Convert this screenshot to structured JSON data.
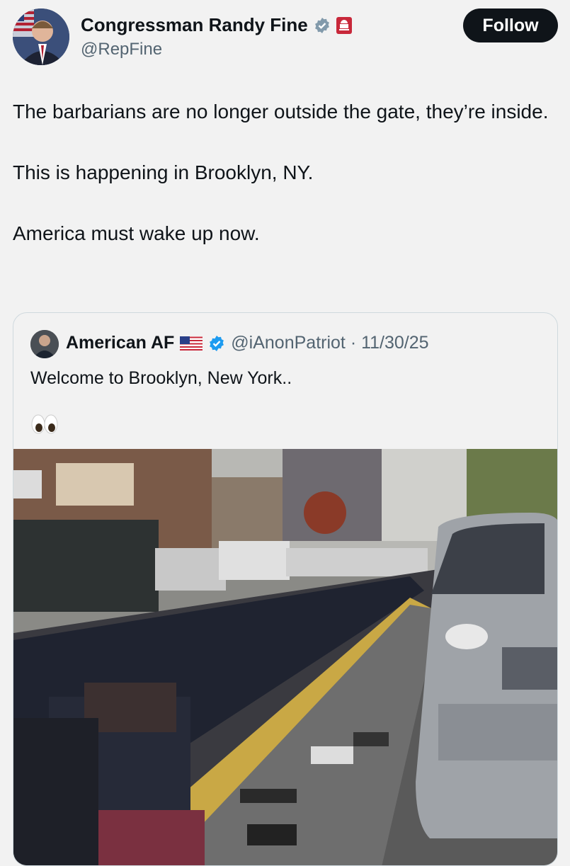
{
  "author": {
    "name": "Congressman Randy Fine",
    "handle": "@RepFine",
    "follow_label": "Follow"
  },
  "tweet": {
    "paragraphs": [
      "The barbarians are no longer outside the gate, they’re inside.",
      "This is happening in Brooklyn, NY.",
      "America must wake up now."
    ]
  },
  "quote": {
    "name": "American AF",
    "handle_date": "@iAnonPatriot · 11/30/25",
    "text": "Welcome to Brooklyn, New York..",
    "emoji": "eyes-emoji"
  },
  "colors": {
    "background": "#f2f2f2",
    "text": "#0f1419",
    "muted": "#536471",
    "verified": "#829aab",
    "follow_bg": "#0f1419"
  }
}
